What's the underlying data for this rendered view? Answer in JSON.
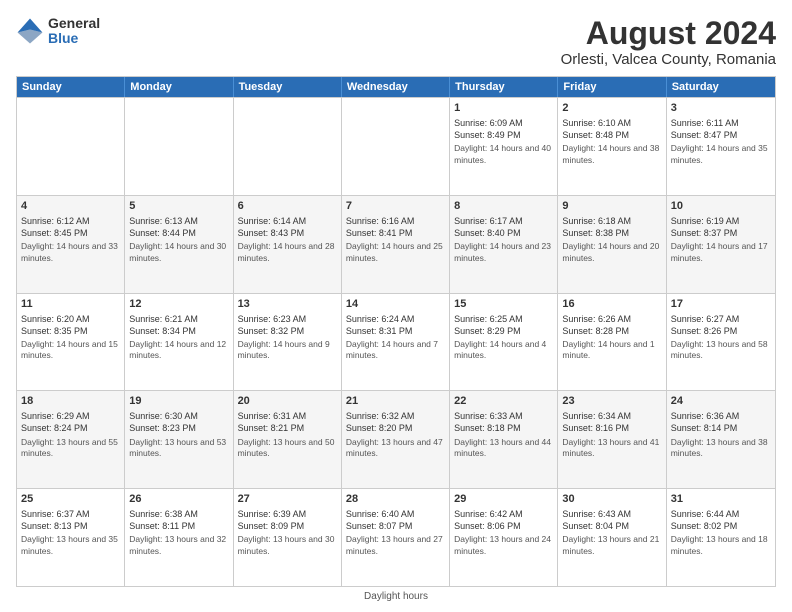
{
  "header": {
    "logo": {
      "general": "General",
      "blue": "Blue"
    },
    "title": "August 2024",
    "subtitle": "Orlesti, Valcea County, Romania"
  },
  "calendar": {
    "weekdays": [
      "Sunday",
      "Monday",
      "Tuesday",
      "Wednesday",
      "Thursday",
      "Friday",
      "Saturday"
    ],
    "weeks": [
      [
        {
          "day": "",
          "empty": true
        },
        {
          "day": "",
          "empty": true
        },
        {
          "day": "",
          "empty": true
        },
        {
          "day": "",
          "empty": true
        },
        {
          "day": "1",
          "sunrise": "Sunrise: 6:09 AM",
          "sunset": "Sunset: 8:49 PM",
          "daylight": "Daylight: 14 hours and 40 minutes."
        },
        {
          "day": "2",
          "sunrise": "Sunrise: 6:10 AM",
          "sunset": "Sunset: 8:48 PM",
          "daylight": "Daylight: 14 hours and 38 minutes."
        },
        {
          "day": "3",
          "sunrise": "Sunrise: 6:11 AM",
          "sunset": "Sunset: 8:47 PM",
          "daylight": "Daylight: 14 hours and 35 minutes."
        }
      ],
      [
        {
          "day": "4",
          "sunrise": "Sunrise: 6:12 AM",
          "sunset": "Sunset: 8:45 PM",
          "daylight": "Daylight: 14 hours and 33 minutes."
        },
        {
          "day": "5",
          "sunrise": "Sunrise: 6:13 AM",
          "sunset": "Sunset: 8:44 PM",
          "daylight": "Daylight: 14 hours and 30 minutes."
        },
        {
          "day": "6",
          "sunrise": "Sunrise: 6:14 AM",
          "sunset": "Sunset: 8:43 PM",
          "daylight": "Daylight: 14 hours and 28 minutes."
        },
        {
          "day": "7",
          "sunrise": "Sunrise: 6:16 AM",
          "sunset": "Sunset: 8:41 PM",
          "daylight": "Daylight: 14 hours and 25 minutes."
        },
        {
          "day": "8",
          "sunrise": "Sunrise: 6:17 AM",
          "sunset": "Sunset: 8:40 PM",
          "daylight": "Daylight: 14 hours and 23 minutes."
        },
        {
          "day": "9",
          "sunrise": "Sunrise: 6:18 AM",
          "sunset": "Sunset: 8:38 PM",
          "daylight": "Daylight: 14 hours and 20 minutes."
        },
        {
          "day": "10",
          "sunrise": "Sunrise: 6:19 AM",
          "sunset": "Sunset: 8:37 PM",
          "daylight": "Daylight: 14 hours and 17 minutes."
        }
      ],
      [
        {
          "day": "11",
          "sunrise": "Sunrise: 6:20 AM",
          "sunset": "Sunset: 8:35 PM",
          "daylight": "Daylight: 14 hours and 15 minutes."
        },
        {
          "day": "12",
          "sunrise": "Sunrise: 6:21 AM",
          "sunset": "Sunset: 8:34 PM",
          "daylight": "Daylight: 14 hours and 12 minutes."
        },
        {
          "day": "13",
          "sunrise": "Sunrise: 6:23 AM",
          "sunset": "Sunset: 8:32 PM",
          "daylight": "Daylight: 14 hours and 9 minutes."
        },
        {
          "day": "14",
          "sunrise": "Sunrise: 6:24 AM",
          "sunset": "Sunset: 8:31 PM",
          "daylight": "Daylight: 14 hours and 7 minutes."
        },
        {
          "day": "15",
          "sunrise": "Sunrise: 6:25 AM",
          "sunset": "Sunset: 8:29 PM",
          "daylight": "Daylight: 14 hours and 4 minutes."
        },
        {
          "day": "16",
          "sunrise": "Sunrise: 6:26 AM",
          "sunset": "Sunset: 8:28 PM",
          "daylight": "Daylight: 14 hours and 1 minute."
        },
        {
          "day": "17",
          "sunrise": "Sunrise: 6:27 AM",
          "sunset": "Sunset: 8:26 PM",
          "daylight": "Daylight: 13 hours and 58 minutes."
        }
      ],
      [
        {
          "day": "18",
          "sunrise": "Sunrise: 6:29 AM",
          "sunset": "Sunset: 8:24 PM",
          "daylight": "Daylight: 13 hours and 55 minutes."
        },
        {
          "day": "19",
          "sunrise": "Sunrise: 6:30 AM",
          "sunset": "Sunset: 8:23 PM",
          "daylight": "Daylight: 13 hours and 53 minutes."
        },
        {
          "day": "20",
          "sunrise": "Sunrise: 6:31 AM",
          "sunset": "Sunset: 8:21 PM",
          "daylight": "Daylight: 13 hours and 50 minutes."
        },
        {
          "day": "21",
          "sunrise": "Sunrise: 6:32 AM",
          "sunset": "Sunset: 8:20 PM",
          "daylight": "Daylight: 13 hours and 47 minutes."
        },
        {
          "day": "22",
          "sunrise": "Sunrise: 6:33 AM",
          "sunset": "Sunset: 8:18 PM",
          "daylight": "Daylight: 13 hours and 44 minutes."
        },
        {
          "day": "23",
          "sunrise": "Sunrise: 6:34 AM",
          "sunset": "Sunset: 8:16 PM",
          "daylight": "Daylight: 13 hours and 41 minutes."
        },
        {
          "day": "24",
          "sunrise": "Sunrise: 6:36 AM",
          "sunset": "Sunset: 8:14 PM",
          "daylight": "Daylight: 13 hours and 38 minutes."
        }
      ],
      [
        {
          "day": "25",
          "sunrise": "Sunrise: 6:37 AM",
          "sunset": "Sunset: 8:13 PM",
          "daylight": "Daylight: 13 hours and 35 minutes."
        },
        {
          "day": "26",
          "sunrise": "Sunrise: 6:38 AM",
          "sunset": "Sunset: 8:11 PM",
          "daylight": "Daylight: 13 hours and 32 minutes."
        },
        {
          "day": "27",
          "sunrise": "Sunrise: 6:39 AM",
          "sunset": "Sunset: 8:09 PM",
          "daylight": "Daylight: 13 hours and 30 minutes."
        },
        {
          "day": "28",
          "sunrise": "Sunrise: 6:40 AM",
          "sunset": "Sunset: 8:07 PM",
          "daylight": "Daylight: 13 hours and 27 minutes."
        },
        {
          "day": "29",
          "sunrise": "Sunrise: 6:42 AM",
          "sunset": "Sunset: 8:06 PM",
          "daylight": "Daylight: 13 hours and 24 minutes."
        },
        {
          "day": "30",
          "sunrise": "Sunrise: 6:43 AM",
          "sunset": "Sunset: 8:04 PM",
          "daylight": "Daylight: 13 hours and 21 minutes."
        },
        {
          "day": "31",
          "sunrise": "Sunrise: 6:44 AM",
          "sunset": "Sunset: 8:02 PM",
          "daylight": "Daylight: 13 hours and 18 minutes."
        }
      ]
    ],
    "footer": "Daylight hours"
  }
}
